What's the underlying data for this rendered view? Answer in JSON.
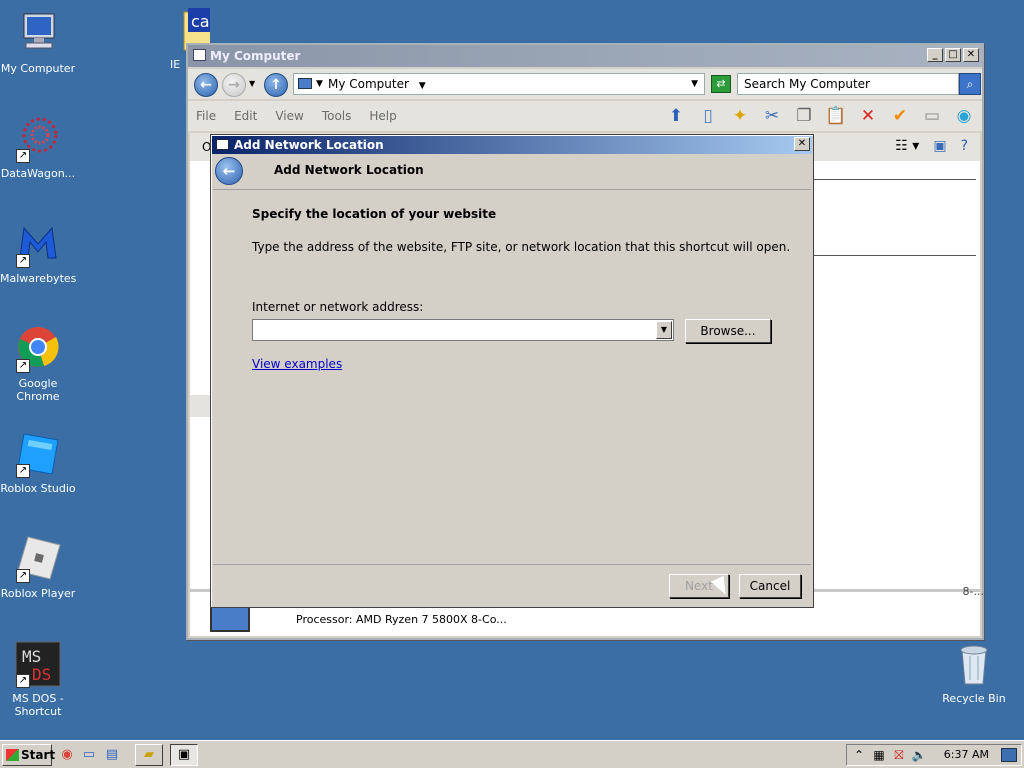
{
  "desktop": {
    "icons": [
      {
        "label": "My Computer",
        "icon": "computer-icon"
      },
      {
        "label": "DataWagon...",
        "icon": "datawagon-icon"
      },
      {
        "label": "Malwarebytes",
        "icon": "malwarebytes-icon"
      },
      {
        "label": "Google Chrome",
        "icon": "chrome-icon"
      },
      {
        "label": "Roblox Studio",
        "icon": "roblox-studio-icon"
      },
      {
        "label": "Roblox Player",
        "icon": "roblox-player-icon"
      },
      {
        "label": "MS DOS - Shortcut",
        "icon": "msdos-icon"
      },
      {
        "label": "Recycle Bin",
        "icon": "recycle-bin-icon"
      },
      {
        "label": "IE",
        "icon": "folder-ca-icon"
      }
    ]
  },
  "mycomputer": {
    "title": "My Computer",
    "address": "My Computer",
    "search_placeholder": "Search My Computer",
    "menu": [
      "File",
      "Edit",
      "View",
      "Tools",
      "Help"
    ],
    "viewbar_left": "O",
    "details": {
      "processor": "Processor: AMD Ryzen 7 5800X 8-Co...",
      "right_fragment": "8-..."
    }
  },
  "dialog": {
    "title": "Add Network Location",
    "heading": "Add Network Location",
    "subtitle": "Specify the location of your website",
    "description": "Type the address of the website, FTP site, or network location that this shortcut will open.",
    "address_label": "Internet or network address:",
    "address_value": "",
    "browse_label": "Browse...",
    "view_examples_label": "View examples",
    "next_label": "Next",
    "cancel_label": "Cancel"
  },
  "taskbar": {
    "start_label": "Start",
    "clock": "6:37 AM"
  },
  "colors": {
    "desktop": "#3a6ea5",
    "dialog_title_start": "#0a246a",
    "dialog_title_end": "#a6caf0",
    "link": "#0000cc"
  }
}
